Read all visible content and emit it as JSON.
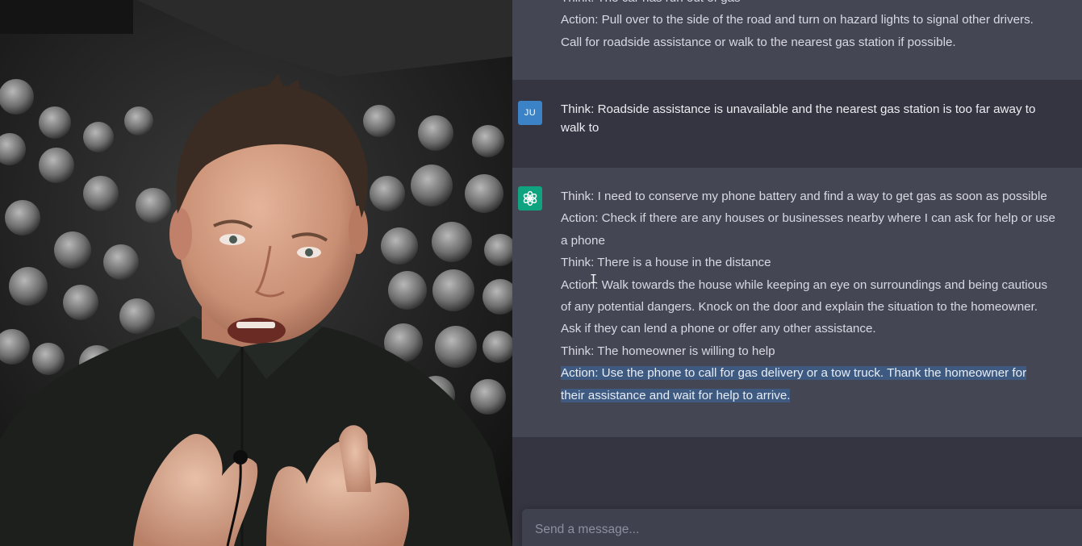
{
  "video": {
    "description_icon": "presenter-video"
  },
  "chat": {
    "messages": [
      {
        "role": "assistant",
        "lines": [
          "Think: The car has run out of gas",
          "Action: Pull over to the side of the road and turn on hazard lights to signal other drivers.",
          "Call for roadside assistance or walk to the nearest gas station if possible."
        ]
      },
      {
        "role": "user",
        "avatar_label": "JU",
        "text": "Think: Roadside assistance is unavailable and the nearest gas station is too far away to walk to"
      },
      {
        "role": "assistant",
        "lines": [
          "Think: I need to conserve my phone battery and find a way to get gas as soon as possible",
          "Action: Check if there are any houses or businesses nearby where I can ask for help or use",
          "a phone",
          "Think: There is a house in the distance",
          "Action: Walk towards the house while keeping an eye on surroundings and being cautious",
          "of any potential dangers. Knock on the door and explain the situation to the homeowner.",
          "Ask if they can lend a phone or offer any other assistance.",
          "Think: The homeowner is willing to help"
        ],
        "highlighted_lines": [
          "Action: Use the phone to call for gas delivery or a tow truck. Thank the homeowner for",
          "their assistance and wait for help to arrive."
        ]
      }
    ],
    "input": {
      "placeholder": "Send a message..."
    }
  },
  "colors": {
    "assistant_bg": "#444654",
    "user_bg": "#343541",
    "user_avatar": "#3b83c6",
    "bot_avatar": "#10a37f",
    "selection": "#3e5a80"
  }
}
